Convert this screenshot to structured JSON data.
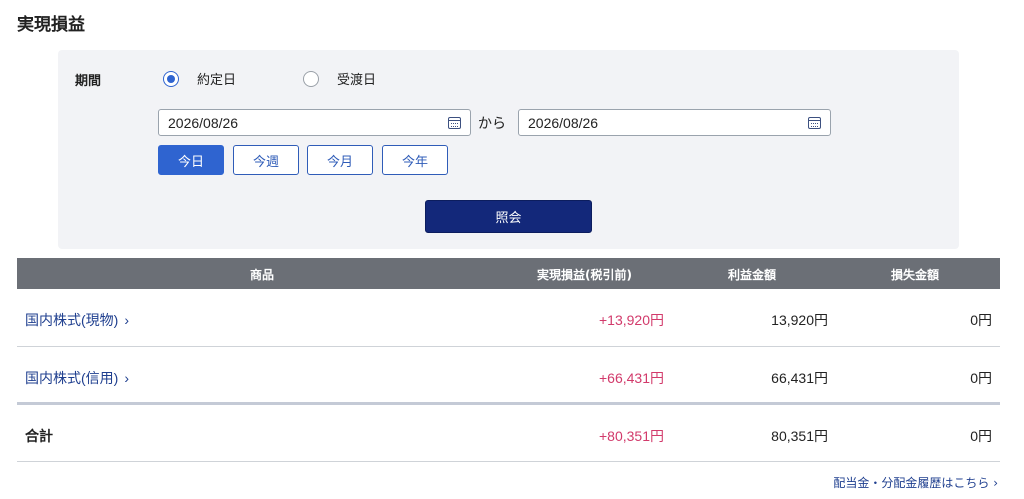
{
  "page": {
    "title": "実現損益"
  },
  "filter": {
    "period_label": "期間",
    "radios": [
      {
        "label": "約定日",
        "selected": true
      },
      {
        "label": "受渡日",
        "selected": false
      }
    ],
    "date_from": "2026/08/26",
    "range_connector": "から",
    "date_to": "2026/08/26",
    "quick_buttons": [
      {
        "label": "今日",
        "active": true
      },
      {
        "label": "今週",
        "active": false
      },
      {
        "label": "今月",
        "active": false
      },
      {
        "label": "今年",
        "active": false
      }
    ],
    "submit_label": "照会"
  },
  "table": {
    "columns": [
      "商品",
      "実現損益(税引前)",
      "利益金額",
      "損失金額"
    ],
    "rows": [
      {
        "product": "国内株式(現物)",
        "realized": "+13,920円",
        "profit": "13,920円",
        "loss": "0円"
      },
      {
        "product": "国内株式(信用)",
        "realized": "+66,431円",
        "profit": "66,431円",
        "loss": "0円"
      }
    ],
    "total": {
      "label": "合計",
      "realized": "+80,351円",
      "profit": "80,351円",
      "loss": "0円"
    }
  },
  "links": {
    "dividend_history": "配当金・分配金履歴はこちら"
  },
  "icons": {
    "calendar": "calendar-icon",
    "chevron": "chevron-right-icon"
  },
  "colors": {
    "accent": "#2f64d0",
    "submit": "#13287a",
    "positive": "#d23a6b",
    "header": "#6b6f76"
  }
}
